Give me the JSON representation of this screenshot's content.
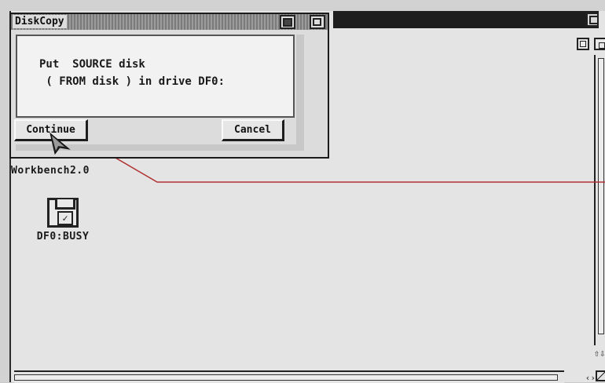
{
  "diskcopy_window": {
    "title": "DiskCopy",
    "message_line1": "Put  SOURCE disk",
    "message_line2": " ( FROM disk ) in drive DF0:",
    "continue_label": "Continue",
    "cancel_label": "Cancel"
  },
  "desktop_icons": [
    {
      "label": "Workbench2.0",
      "icon": "workbench-disk-icon"
    },
    {
      "label": "DF0:BUSY",
      "icon": "floppy-disk-icon"
    }
  ],
  "workbench_window": {
    "scroll_arrows_vertical": "⇧⇩",
    "scroll_arrows_horizontal": "‹›"
  },
  "colors": {
    "connector_line": "#b03030",
    "titlebar_dark": "#1e1e1e",
    "window_bg": "#e4e4e4"
  }
}
